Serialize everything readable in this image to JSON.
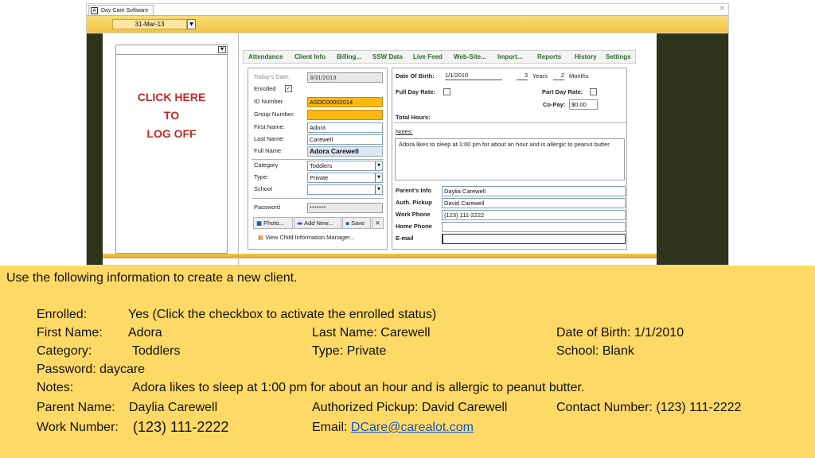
{
  "window": {
    "tab_title": "Day Care Software",
    "tab_icon": "access-app-icon",
    "close_glyph": "×",
    "date_value": "31-Mar-13"
  },
  "nav_pane": {
    "logoff_line1": "CLICK HERE",
    "logoff_line2": "TO",
    "logoff_line3": "LOG OFF"
  },
  "tabs": [
    "Attendance",
    "Client Info",
    "Billing...",
    "SSW Data",
    "Live Feed",
    "Web-Site...",
    "Import...",
    "Reports",
    "History",
    "Settings"
  ],
  "form_left": {
    "todays_date_label": "Today's Date:",
    "todays_date_value": "3/31/2013",
    "enrolled_label": "Enrolled",
    "enrolled_checked": true,
    "id_number_label": "ID Number",
    "id_number_value": "ASDC00002014",
    "group_number_label": "Group Number:",
    "group_number_value": "",
    "first_name_label": "First Name:",
    "first_name_value": "Adora",
    "last_name_label": "Last Name:",
    "last_name_value": "Carewell",
    "full_name_label": "Full Name",
    "full_name_value": "Adora Carewell",
    "category_label": "Category",
    "category_value": "Toddlers",
    "type_label": "Type:",
    "type_value": "Private",
    "school_label": "School",
    "school_value": "",
    "password_label": "Password",
    "password_value": "*******",
    "photo_button": "Photo...",
    "add_new_button": "Add New...",
    "save_button": "Save",
    "view_manager_link": "View Child Information Manager..."
  },
  "form_right": {
    "dob_label": "Date Of Birth:",
    "dob_value": "1/1/2010",
    "years_value": "3",
    "years_label": "Years",
    "months_value": "2",
    "months_label": "Months",
    "full_day_rate_label": "Full Day Rate:",
    "part_day_rate_label": "Part Day Rate:",
    "copay_label": "Co-Pay:",
    "copay_value": "$0.00",
    "total_hours_label": "Total Hours:",
    "notes_label": "Notes:",
    "notes_value": "Adora likes to sleep at 1:00 pm for about an hour and is allergic to peanut butter.",
    "parents_info_label": "Parent's Info",
    "parents_info_value": "Daylia Carewell",
    "auth_pickup_label": "Auth. Pickup",
    "auth_pickup_value": "David Carewell",
    "work_phone_label": "Work Phone",
    "work_phone_value": "(123) 111-2222",
    "home_phone_label": "Home Phone",
    "home_phone_value": "",
    "email_label": "E-mail",
    "email_value": ""
  },
  "instructions": {
    "intro": "Use the following information to create a new client.",
    "enrolled_label": "Enrolled:",
    "enrolled_value": "Yes (Click the checkbox to activate the enrolled status)",
    "first_name_label": "First Name:",
    "first_name_value": "Adora",
    "last_name": "Last Name: Carewell",
    "dob": "Date of Birth: 1/1/2010",
    "category_label": "Category:",
    "category_value": "Toddlers",
    "type": "Type: Private",
    "school": "School: Blank",
    "password": "Password: daycare",
    "notes_label": "Notes:",
    "notes_value": "Adora likes to sleep at 1:00 pm for about an hour and is allergic to peanut butter.",
    "parent_name_label": "Parent Name:",
    "parent_name_value": "Daylia Carewell",
    "authorized_pickup": "Authorized Pickup: David Carewell",
    "contact_number": "Contact Number: (123) 111-2222",
    "work_number_label": "Work Number:",
    "work_number_value": "(123) 111-2222",
    "email_label": "Email:",
    "email_value": "DCare@carealot.com"
  }
}
